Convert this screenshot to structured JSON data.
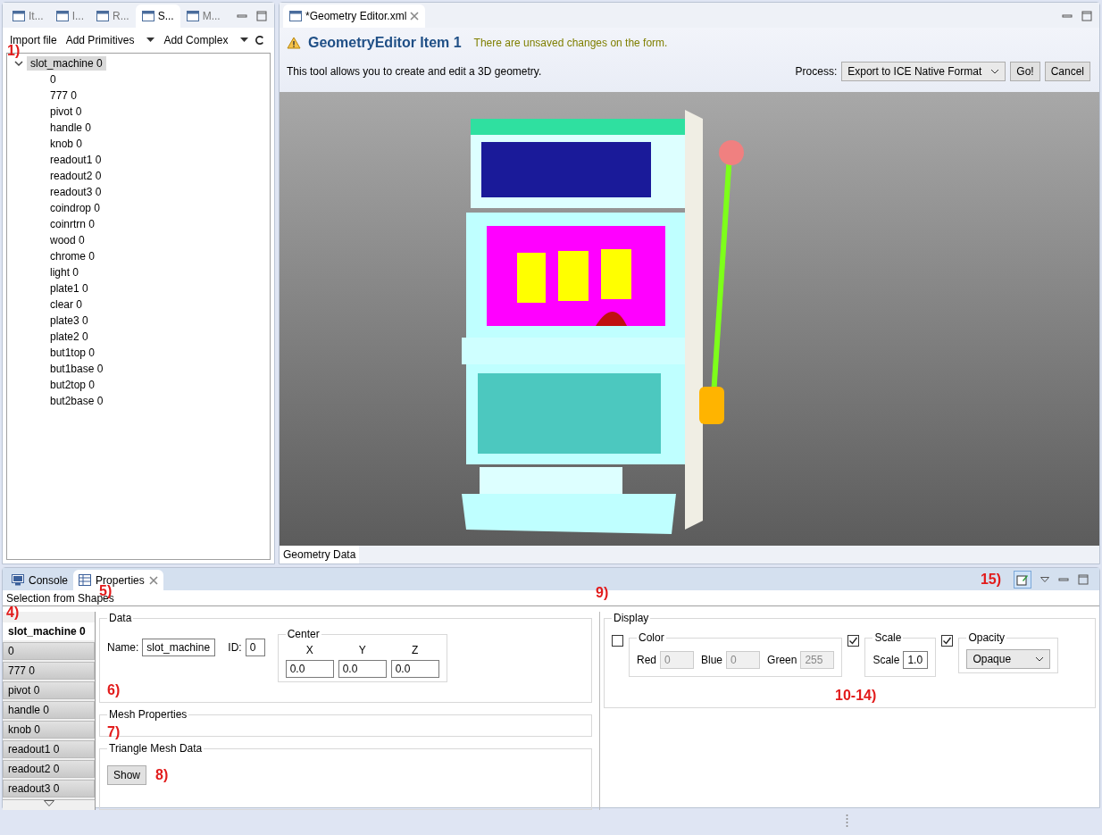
{
  "left_view": {
    "tabs": [
      {
        "label": "It...",
        "selected": false
      },
      {
        "label": "I...",
        "selected": false
      },
      {
        "label": "R...",
        "selected": false
      },
      {
        "label": "S...",
        "selected": true
      },
      {
        "label": "M...",
        "selected": false
      }
    ],
    "toolbar": [
      {
        "label": "Import file",
        "kind": "button"
      },
      {
        "label": "Add Primitives",
        "kind": "dropdown"
      },
      {
        "label": "Add Complex",
        "kind": "dropdown"
      }
    ],
    "callout": "1)",
    "tree": [
      {
        "label": "slot_machine 0",
        "expanded": true,
        "selected": true,
        "children": [
          {
            "label": "0",
            "selected": false
          },
          {
            "label": "777 0",
            "selected": false
          },
          {
            "label": "pivot 0",
            "selected": false
          },
          {
            "label": "handle 0",
            "selected": false
          },
          {
            "label": "knob 0",
            "selected": false
          },
          {
            "label": "readout1 0",
            "selected": false
          },
          {
            "label": "readout2 0",
            "selected": false
          },
          {
            "label": "readout3 0",
            "selected": false
          },
          {
            "label": "coindrop 0",
            "selected": false
          },
          {
            "label": "coinrtrn 0",
            "selected": false
          },
          {
            "label": "wood 0",
            "selected": false
          },
          {
            "label": "chrome 0",
            "selected": false
          },
          {
            "label": "light 0",
            "selected": false
          },
          {
            "label": "plate1 0",
            "selected": false
          },
          {
            "label": "clear 0",
            "selected": false
          },
          {
            "label": "plate3 0",
            "selected": false
          },
          {
            "label": "plate2 0",
            "selected": false
          },
          {
            "label": "but1top 0",
            "selected": false
          },
          {
            "label": "but1base 0",
            "selected": false
          },
          {
            "label": "but2top 0",
            "selected": false
          },
          {
            "label": "but2base 0",
            "selected": false
          }
        ]
      }
    ]
  },
  "editor": {
    "tab": "*Geometry Editor.xml",
    "title": "GeometryEditor Item 1",
    "warning": "There are unsaved changes on the form.",
    "description": "This tool allows you to create and edit a 3D geometry.",
    "process_label": "Process:",
    "process_value": "Export to ICE Native Format",
    "buttons": [
      "Go!",
      "Cancel"
    ],
    "bottom_tabs": [
      {
        "label": "Geometry Data",
        "selected": true
      }
    ]
  },
  "bottom_view": {
    "tabs": [
      {
        "label": "Console",
        "kind": "console",
        "selected": false
      },
      {
        "label": "Properties",
        "kind": "properties",
        "selected": true
      }
    ],
    "toolbar_callout": "15)",
    "selection_title": "Selection from Shapes",
    "callout_list": "4)",
    "callout_title": "5)",
    "callout_display": "9)",
    "shape_list": [
      {
        "label": "slot_machine 0",
        "selected": true
      },
      {
        "label": "0",
        "selected": false
      },
      {
        "label": "777 0",
        "selected": false
      },
      {
        "label": "pivot 0",
        "selected": false
      },
      {
        "label": "handle 0",
        "selected": false
      },
      {
        "label": "knob 0",
        "selected": false
      },
      {
        "label": "readout1 0",
        "selected": false
      },
      {
        "label": "readout2 0",
        "selected": false
      },
      {
        "label": "readout3 0",
        "selected": false
      }
    ],
    "data": {
      "legend": "Data",
      "name_label": "Name:",
      "name_value": "slot_machine",
      "id_label": "ID:",
      "id_value": "0",
      "callout": "6)",
      "center": {
        "legend": "Center",
        "axes": [
          {
            "label": "X",
            "value": "0.0"
          },
          {
            "label": "Y",
            "value": "0.0"
          },
          {
            "label": "Z",
            "value": "0.0"
          }
        ]
      }
    },
    "mesh_properties": {
      "legend": "Mesh Properties",
      "callout": "7)"
    },
    "triangle_mesh": {
      "legend": "Triangle Mesh Data",
      "button": "Show",
      "callout": "8)"
    },
    "display": {
      "legend": "Display",
      "callout": "10-14)",
      "color": {
        "legend": "Color",
        "checked": false,
        "fields": [
          {
            "label": "Red",
            "value": "0",
            "disabled": true
          },
          {
            "label": "Blue",
            "value": "0",
            "disabled": true
          },
          {
            "label": "Green",
            "value": "255",
            "disabled": true
          }
        ]
      },
      "scale": {
        "legend": "Scale",
        "checked": true,
        "label": "Scale",
        "value": "1.0"
      },
      "opacity": {
        "legend": "Opacity",
        "checked": true,
        "value": "Opaque"
      }
    }
  }
}
